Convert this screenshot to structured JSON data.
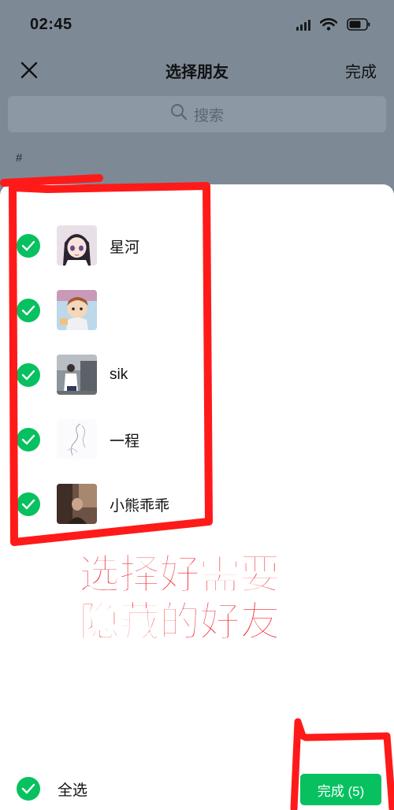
{
  "status_bar": {
    "time": "02:45"
  },
  "nav": {
    "title": "选择朋友",
    "done_label": "完成"
  },
  "search": {
    "placeholder": "搜索"
  },
  "section": {
    "letter": "#"
  },
  "friends": [
    {
      "name": "星河",
      "selected": true,
      "avatar": "anime-girl-avatar"
    },
    {
      "name": "",
      "selected": true,
      "avatar": "cartoon-avatar"
    },
    {
      "name": "sik",
      "selected": true,
      "avatar": "photo-avatar"
    },
    {
      "name": "一程",
      "selected": true,
      "avatar": "sketch-avatar"
    },
    {
      "name": "小熊乖乖",
      "selected": true,
      "avatar": "dark-photo-avatar"
    }
  ],
  "annotation": {
    "line1": "选择好需要",
    "line2": "隐藏的好友"
  },
  "bottom": {
    "select_all_label": "全选",
    "done_label": "完成 (5)",
    "selected_count": 5
  },
  "colors": {
    "accent": "#07c160",
    "annotation": "#f0141e",
    "overlay": "#7d8a96"
  }
}
